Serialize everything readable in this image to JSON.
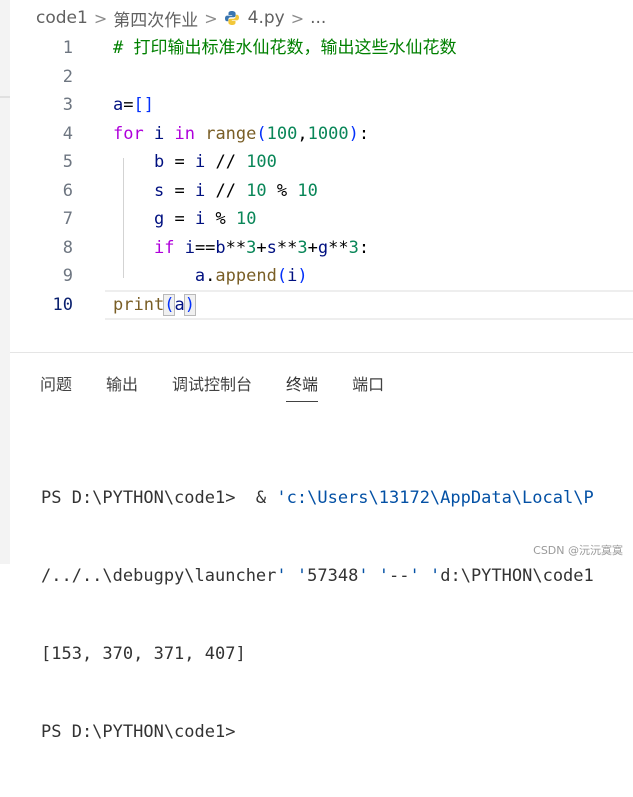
{
  "breadcrumb": {
    "items": [
      "code1",
      "第四次作业",
      "4.py",
      "..."
    ],
    "separator": ">"
  },
  "editor": {
    "line_numbers": [
      "1",
      "2",
      "3",
      "4",
      "5",
      "6",
      "7",
      "8",
      "9",
      "10"
    ],
    "active_line": "10",
    "lines": [
      "# 打印输出标准水仙花数，输出这些水仙花数",
      "",
      "a=[]",
      "for i in range(100,1000):",
      "    b = i // 100",
      "    s = i // 10 % 10",
      "    g = i % 10",
      "    if i==b**3+s**3+g**3:",
      "        a.append(i)",
      "print(a)"
    ]
  },
  "panel": {
    "tabs": [
      "问题",
      "输出",
      "调试控制台",
      "终端",
      "端口"
    ],
    "active_tab": "终端",
    "terminal_lines": [
      "PS D:\\PYTHON\\code1>  & 'c:\\Users\\13172\\AppData\\Local\\P",
      "/../..\\debugpy\\launcher' '57348' '--' 'd:\\PYTHON\\code1",
      "[153, 370, 371, 407]",
      "PS D:\\PYTHON\\code1>"
    ]
  },
  "watermark": "CSDN @沅沅寞寞",
  "colors": {
    "keyword": "#af00db",
    "builtin": "#795e26",
    "number": "#098658",
    "variable": "#001080",
    "comment": "#008000",
    "string": "#0451a5"
  },
  "icons": {
    "file_type": "python-icon",
    "separator": "chevron-right-icon"
  }
}
